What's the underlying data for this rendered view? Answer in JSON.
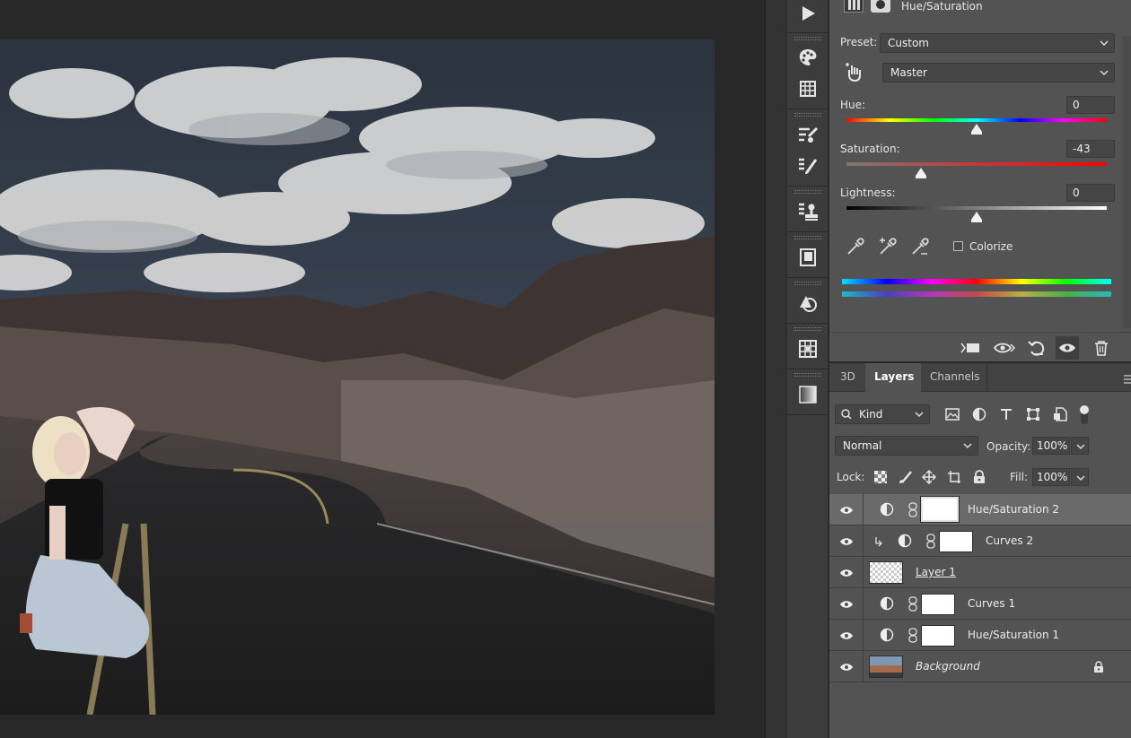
{
  "properties": {
    "title": "Hue/Saturation",
    "preset_label": "Preset:",
    "preset_value": "Custom",
    "channel_value": "Master",
    "hue_label": "Hue:",
    "hue_value": "0",
    "saturation_label": "Saturation:",
    "saturation_value": "-43",
    "lightness_label": "Lightness:",
    "lightness_value": "0",
    "colorize_label": "Colorize",
    "hue_fraction": 0.5,
    "saturation_fraction": 0.285,
    "lightness_fraction": 0.5
  },
  "layers_panel": {
    "tabs": [
      {
        "label": "3D"
      },
      {
        "label": "Layers"
      },
      {
        "label": "Channels"
      }
    ],
    "filter_kind": "Kind",
    "blend_mode": "Normal",
    "opacity_label": "Opacity:",
    "opacity_value": "100%",
    "lock_label": "Lock:",
    "fill_label": "Fill:",
    "fill_value": "100%",
    "layers": [
      {
        "name": "Hue/Saturation 2"
      },
      {
        "name": "Curves 2"
      },
      {
        "name": "Layer 1"
      },
      {
        "name": "Curves 1"
      },
      {
        "name": "Hue/Saturation 1"
      },
      {
        "name": "Background"
      }
    ]
  },
  "colors": {
    "panel_bg": "#535353",
    "canvas_bg": "#282828",
    "selected_row": "#6a6a6a"
  }
}
